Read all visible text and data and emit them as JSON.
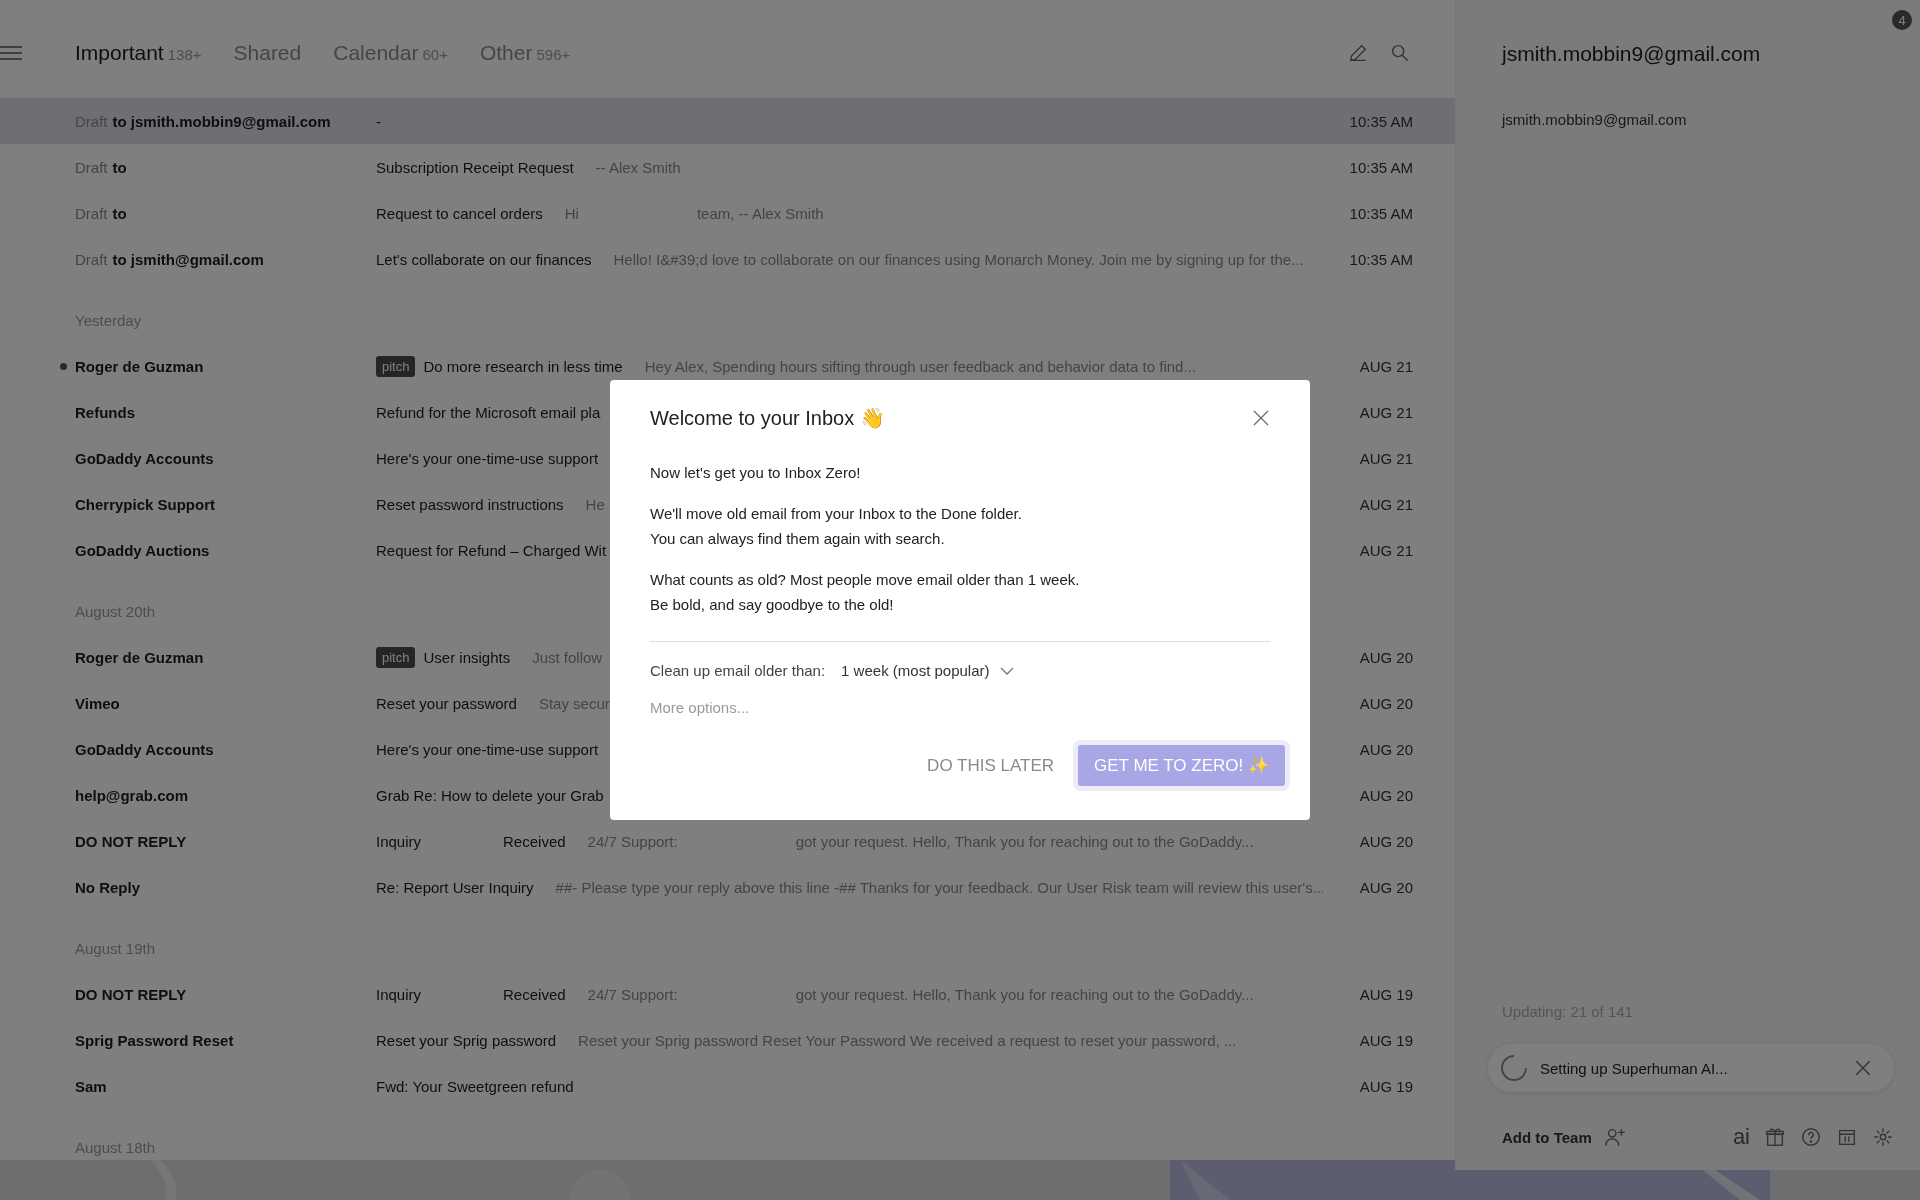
{
  "tabs": [
    {
      "label": "Important",
      "count": "138+",
      "selected": true
    },
    {
      "label": "Shared",
      "selected": false
    },
    {
      "label": "Calendar",
      "count": "60+",
      "selected": false
    },
    {
      "label": "Other",
      "count": "596+",
      "selected": false
    }
  ],
  "list": [
    {
      "kind": "email",
      "draft_label": "Draft",
      "from": "to jsmith.mobbin9@gmail.com",
      "subject": [
        "-"
      ],
      "date": "10:35 AM",
      "selected": true,
      "unread": false
    },
    {
      "kind": "email",
      "draft_label": "Draft",
      "from": "to",
      "subject": [
        "Subscription Receipt Request"
      ],
      "snippet": [
        "-- Alex Smith"
      ],
      "date": "10:35 AM",
      "selected": false,
      "unread": false
    },
    {
      "kind": "email",
      "draft_label": "Draft",
      "from": "to",
      "subject": [
        "Request to cancel orders"
      ],
      "snippet": [
        "Hi",
        "team, -- Alex Smith"
      ],
      "date": "10:35 AM",
      "selected": false,
      "unread": false
    },
    {
      "kind": "email",
      "draft_label": "Draft",
      "from": "to jsmith@gmail.com",
      "subject": [
        "Let's collaborate on our finances"
      ],
      "snippet": [
        "Hello! I&#39;d love to collaborate on our finances using Monarch Money. Join me by signing up for the..."
      ],
      "date": "10:35 AM",
      "selected": false,
      "unread": false
    },
    {
      "kind": "group",
      "label": "Yesterday"
    },
    {
      "kind": "email",
      "from": "Roger de Guzman",
      "tag": "pitch",
      "subject": [
        "Do more research in less time"
      ],
      "snippet": [
        "Hey Alex, Spending hours sifting through user feedback and behavior data to find..."
      ],
      "date": "AUG 21",
      "selected": false,
      "unread": true
    },
    {
      "kind": "email",
      "from": "Refunds",
      "subject": [
        "Refund for the Microsoft email pla"
      ],
      "date": "AUG 21",
      "selected": false,
      "unread": false
    },
    {
      "kind": "email",
      "from": "GoDaddy Accounts",
      "subject": [
        "Here's your one-time-use support"
      ],
      "date": "AUG 21",
      "selected": false,
      "unread": false
    },
    {
      "kind": "email",
      "from": "Cherrypick Support",
      "subject": [
        "Reset password instructions"
      ],
      "snippet": [
        "He"
      ],
      "date": "AUG 21",
      "selected": false,
      "unread": false
    },
    {
      "kind": "email",
      "from": "GoDaddy Auctions",
      "subject": [
        "Request for Refund – Charged Wit"
      ],
      "date": "AUG 21",
      "selected": false,
      "unread": false
    },
    {
      "kind": "group",
      "label": "August 20th"
    },
    {
      "kind": "email",
      "from": "Roger de Guzman",
      "tag": "pitch",
      "subject": [
        "User insights"
      ],
      "snippet": [
        "Just follow"
      ],
      "date": "AUG 20",
      "selected": false,
      "unread": false
    },
    {
      "kind": "email",
      "from": "Vimeo",
      "subject": [
        "Reset your password"
      ],
      "snippet": [
        "Stay secur"
      ],
      "date": "AUG 20",
      "selected": false,
      "unread": false
    },
    {
      "kind": "email",
      "from": "GoDaddy Accounts",
      "subject": [
        "Here's your one-time-use support"
      ],
      "date": "AUG 20",
      "selected": false,
      "unread": false
    },
    {
      "kind": "email",
      "from": "help@grab.com",
      "subject": [
        "Grab Re: How to delete your Grab"
      ],
      "date": "AUG 20",
      "selected": false,
      "unread": false
    },
    {
      "kind": "email",
      "from": "DO NOT REPLY",
      "subject": [
        "Inquiry",
        "Received"
      ],
      "snippet": [
        "24/7 Support:",
        "got your request. Hello, Thank you for reaching out to the GoDaddy..."
      ],
      "date": "AUG 20",
      "selected": false,
      "unread": false
    },
    {
      "kind": "email",
      "from": "No Reply",
      "subject": [
        "Re: Report User Inquiry"
      ],
      "snippet": [
        "##- Please type your reply above this line -## Thanks for your feedback. Our User Risk team will review this user's..."
      ],
      "date": "AUG 20",
      "selected": false,
      "unread": false
    },
    {
      "kind": "group",
      "label": "August 19th"
    },
    {
      "kind": "email",
      "from": "DO NOT REPLY",
      "subject": [
        "Inquiry",
        "Received"
      ],
      "snippet": [
        "24/7 Support:",
        "got your request. Hello, Thank you for reaching out to the GoDaddy..."
      ],
      "date": "AUG 19",
      "selected": false,
      "unread": false
    },
    {
      "kind": "email",
      "from": "Sprig Password Reset",
      "subject": [
        "Reset your Sprig password"
      ],
      "snippet": [
        "Reset your Sprig password Reset Your Password We received a request to reset your password, ..."
      ],
      "date": "AUG 19",
      "selected": false,
      "unread": false
    },
    {
      "kind": "email",
      "from": "Sam",
      "subject": [
        "Fwd: Your Sweetgreen refund"
      ],
      "date": "AUG 19",
      "selected": false,
      "unread": false
    },
    {
      "kind": "group",
      "label": "August 18th"
    }
  ],
  "contact": {
    "title": "jsmith.mobbin9@gmail.com",
    "email": "jsmith.mobbin9@gmail.com"
  },
  "notification_badge": "4",
  "status": "Updating: 21 of 141",
  "ai_setup": "Setting up Superhuman AI...",
  "footer": {
    "add_team": "Add to Team",
    "ai": "ai"
  },
  "modal": {
    "title": "Welcome to your Inbox 👋",
    "paragraphs": [
      [
        "Now let's get you to Inbox Zero!"
      ],
      [
        "We'll move old email from your Inbox to the Done folder.",
        "You can always find them again with search."
      ],
      [
        "What counts as old? Most people move email older than 1 week.",
        "Be bold, and say goodbye to the old!"
      ]
    ],
    "option_label": "Clean up email older than:",
    "option_value": "1 week (most popular)",
    "more": "More options...",
    "buttons": [
      {
        "kind": "secondary",
        "label": "DO THIS LATER"
      },
      {
        "kind": "primary",
        "label": "GET ME TO ZERO! ✨"
      }
    ]
  }
}
